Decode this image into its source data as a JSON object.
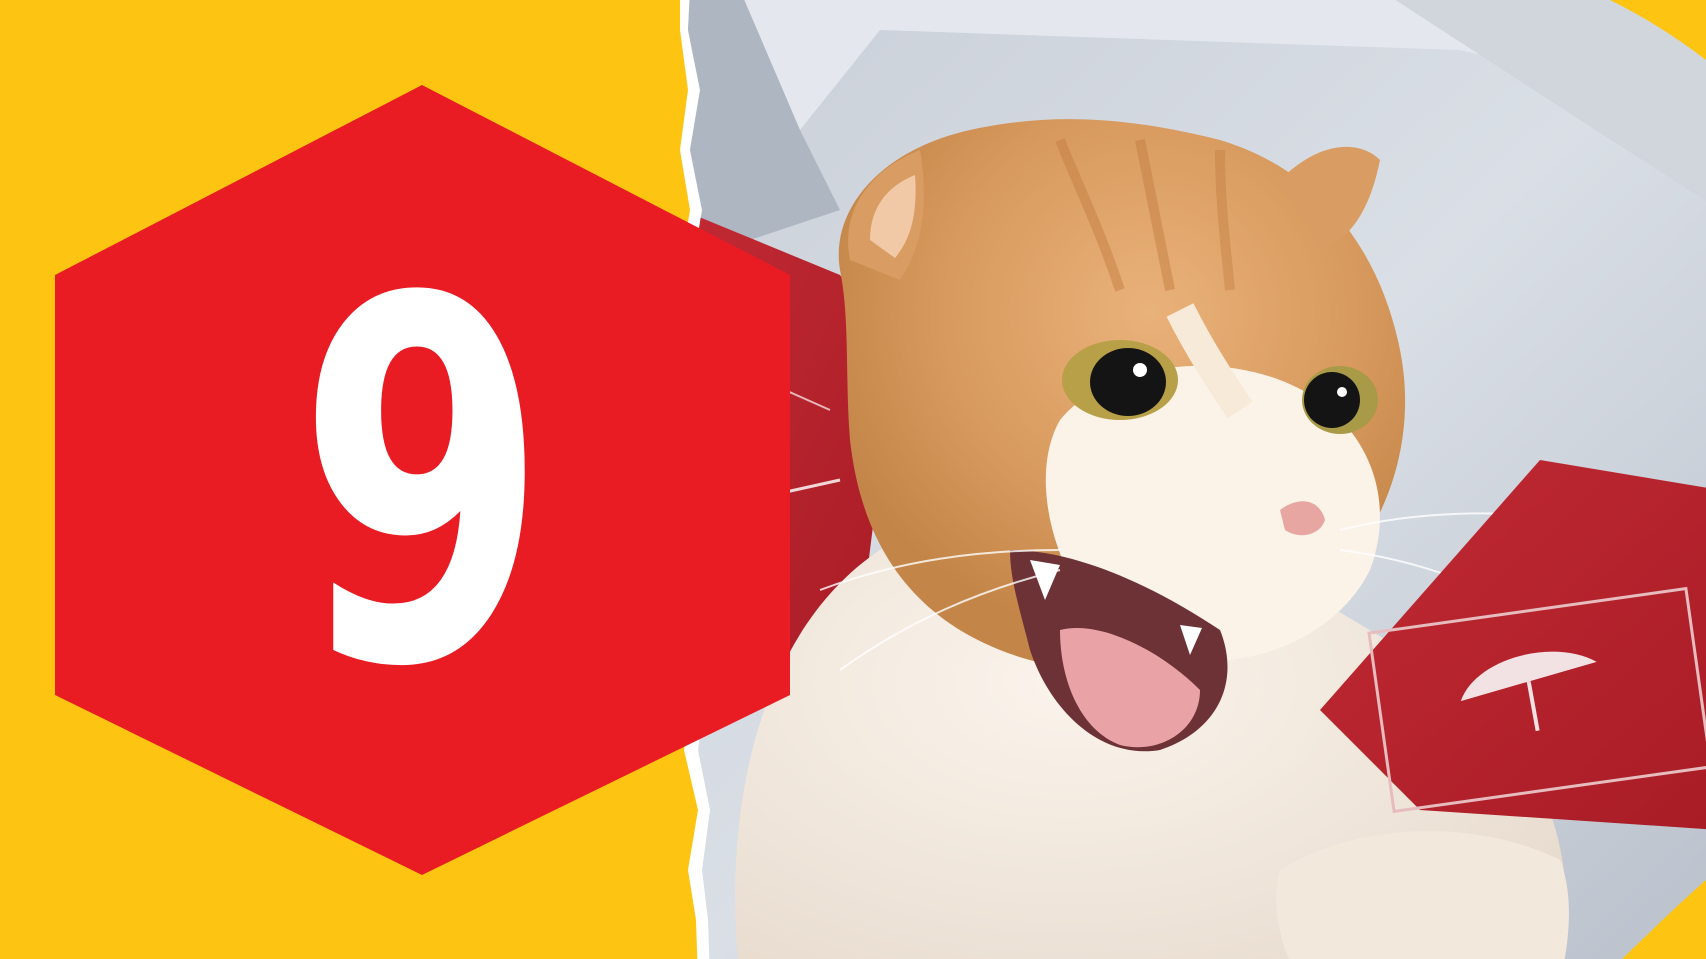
{
  "badge": {
    "number": "9",
    "color": "#E91C24",
    "text_color": "#FFFFFF"
  },
  "background": {
    "color": "#FDC512"
  },
  "photo": {
    "subject": "hissing-orange-white-cat-in-box",
    "border_color": "#FFFFFF"
  }
}
